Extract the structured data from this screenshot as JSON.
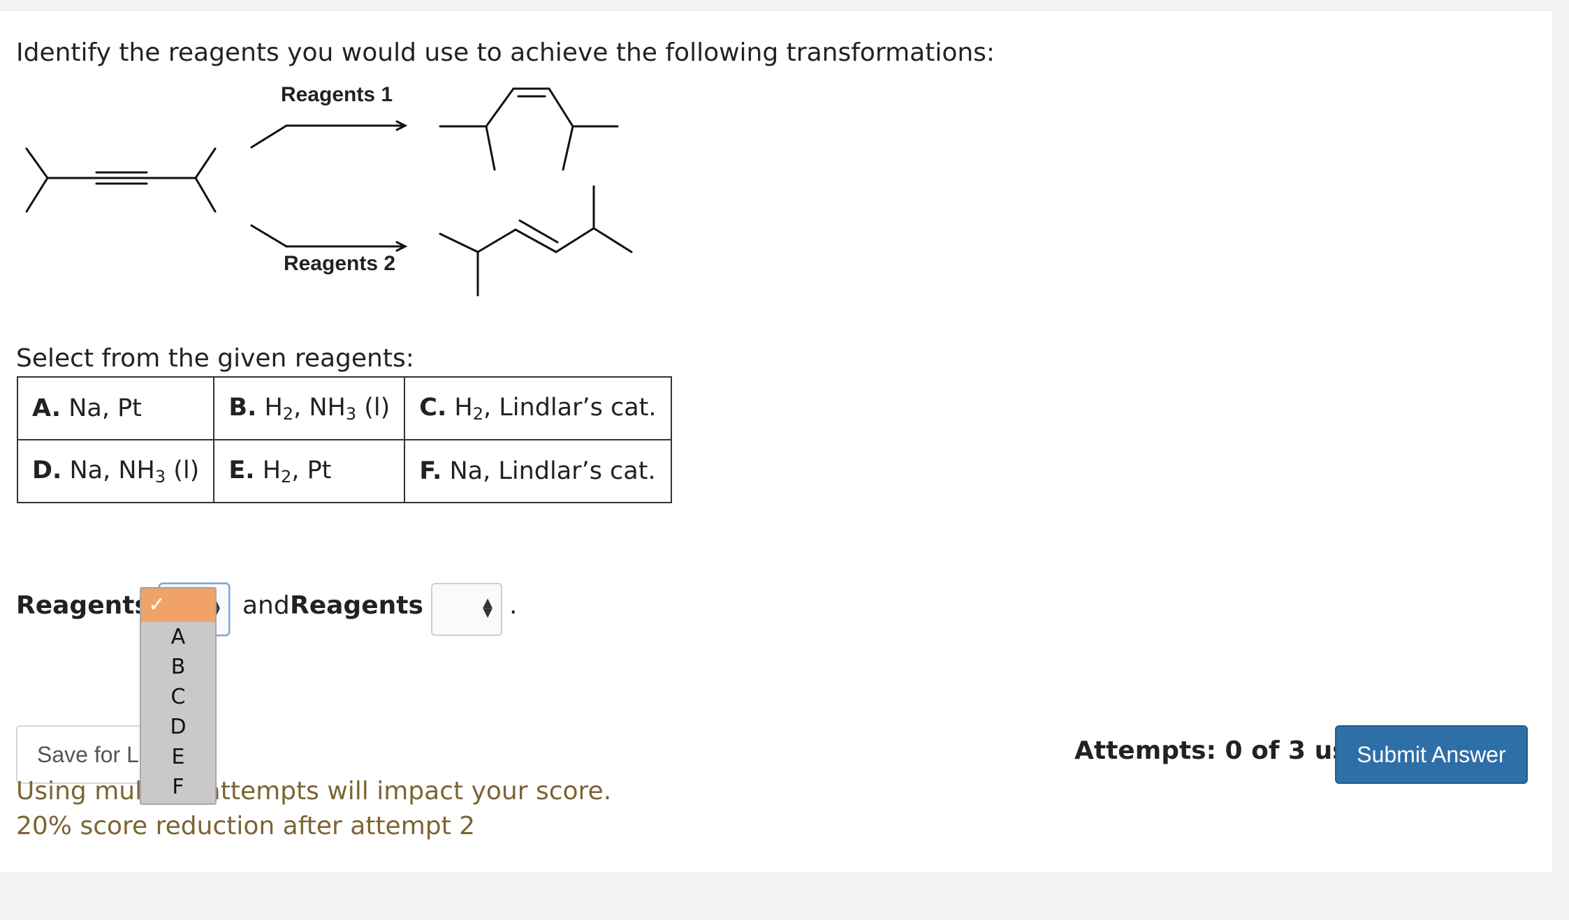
{
  "question": "Identify the reagents you would use to achieve the following transformations:",
  "scheme": {
    "top_arrow_label": "Reagents 1",
    "bottom_arrow_label": "Reagents 2"
  },
  "select_label": "Select from the given reagents:",
  "options": [
    {
      "letter": "A.",
      "text": "Na, Pt"
    },
    {
      "letter": "B.",
      "pre": "H",
      "sub": "2",
      "mid": ", NH",
      "sub2": "3",
      "post": " (l)"
    },
    {
      "letter": "C.",
      "pre": "H",
      "sub": "2",
      "post": ", Lindlar’s cat."
    },
    {
      "letter": "D.",
      "pre": "Na, NH",
      "sub": "3",
      "post": " (l)"
    },
    {
      "letter": "E.",
      "pre": "H",
      "sub": "2",
      "post": ", Pt"
    },
    {
      "letter": "F.",
      "text": "Na, Lindlar’s cat."
    }
  ],
  "answer": {
    "reagents1_label": "Reagents 1",
    "and_label": "and",
    "reagents2_label": "Reagents 2",
    "period": "."
  },
  "dropdown": {
    "selected": "✓",
    "options": [
      "A",
      "B",
      "C",
      "D",
      "E",
      "F"
    ]
  },
  "save_label": "Save for Later",
  "attempts": "Attempts: 0 of 3 used",
  "submit_label": "Submit Answer",
  "note1": "Using multiple attempts will impact your score.",
  "note2": "20% score reduction after attempt 2",
  "colors": {
    "submit": "#2f6fa8",
    "note": "#7c6433",
    "dropdown_highlight": "#f0a267"
  }
}
